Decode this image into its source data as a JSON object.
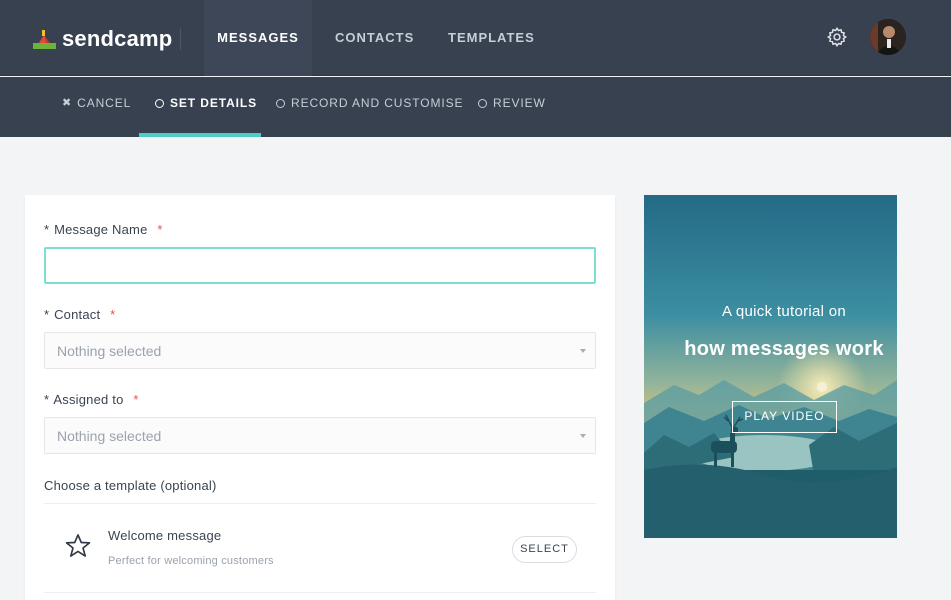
{
  "topbar": {
    "logo_text": "sendcamp",
    "nav": [
      {
        "label": "MESSAGES",
        "active": true
      },
      {
        "label": "CONTACTS",
        "active": false
      },
      {
        "label": "TEMPLATES",
        "active": false
      }
    ],
    "settings_icon": "gear-icon",
    "avatar_icon": "user-avatar"
  },
  "steps": {
    "cancel": "CANCEL",
    "details": "SET DETAILS",
    "record": "RECORD AND CUSTOMISE",
    "review": "REVIEW",
    "active_step": "SET DETAILS",
    "accent": "#4ecdc4"
  },
  "form": {
    "message_name": {
      "label": "Message Name",
      "prefix": "*",
      "required_mark": "*",
      "value": ""
    },
    "contact": {
      "label": "Contact",
      "prefix": "*",
      "required_mark": "*",
      "placeholder": "Nothing selected"
    },
    "assigned": {
      "label": "Assigned to",
      "prefix": "*",
      "required_mark": "*",
      "placeholder": "Nothing selected"
    },
    "template_heading": "Choose a template (optional)",
    "templates": [
      {
        "name": "Welcome message",
        "description": "Perfect for welcoming customers",
        "button": "SELECT",
        "icon": "star-icon"
      }
    ]
  },
  "tutorial": {
    "line1": "A quick tutorial on",
    "line2": "how messages work",
    "button": "PLAY VIDEO"
  },
  "colors": {
    "header_bg": "#384150",
    "page_bg": "#f3f4f6",
    "required": "#e5505b",
    "focus_border": "#7ddfd2"
  }
}
